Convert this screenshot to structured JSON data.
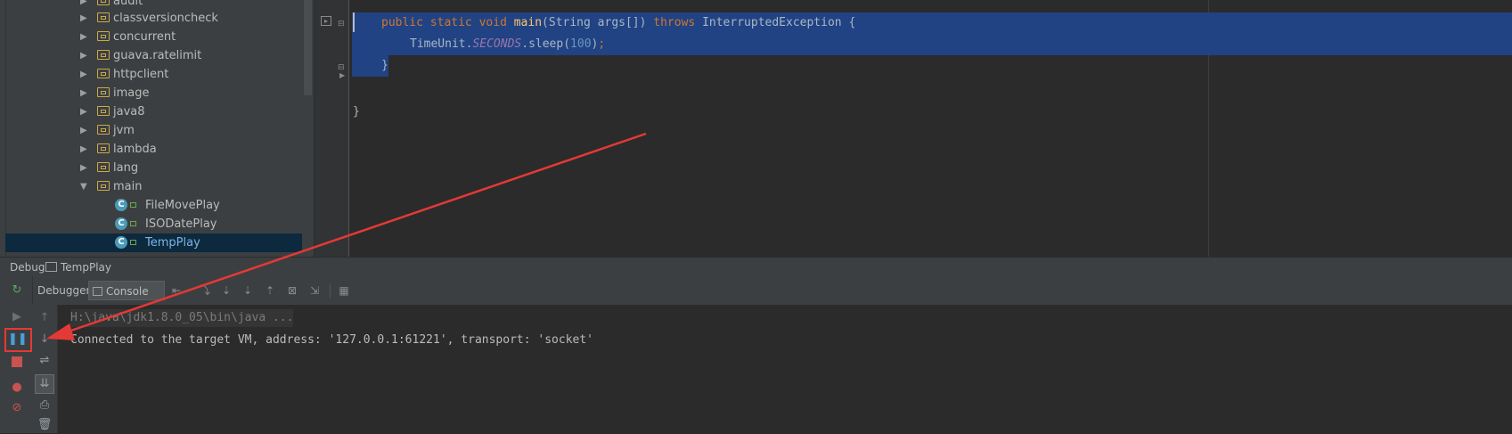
{
  "project_tree": {
    "items": [
      {
        "label": "audit",
        "type": "folder",
        "expanded": false
      },
      {
        "label": "classversioncheck",
        "type": "folder",
        "expanded": false
      },
      {
        "label": "concurrent",
        "type": "folder",
        "expanded": false
      },
      {
        "label": "guava.ratelimit",
        "type": "folder",
        "expanded": false
      },
      {
        "label": "httpclient",
        "type": "folder",
        "expanded": false
      },
      {
        "label": "image",
        "type": "folder",
        "expanded": false
      },
      {
        "label": "java8",
        "type": "folder",
        "expanded": false
      },
      {
        "label": "jvm",
        "type": "folder",
        "expanded": false
      },
      {
        "label": "lambda",
        "type": "folder",
        "expanded": false
      },
      {
        "label": "lang",
        "type": "folder",
        "expanded": false
      },
      {
        "label": "main",
        "type": "folder",
        "expanded": true
      },
      {
        "label": "FileMovePlay",
        "type": "class"
      },
      {
        "label": "ISODatePlay",
        "type": "class"
      },
      {
        "label": "TempPlay",
        "type": "class",
        "selected": true
      }
    ]
  },
  "editor": {
    "line1": {
      "kw1": "public",
      "kw2": "static",
      "kw3": "void",
      "method": "main",
      "params": "(String args[])",
      "kw4": "throws",
      "exc": "InterruptedException {"
    },
    "line2": {
      "cls": "TimeUnit.",
      "field": "SECONDS",
      "call": ".sleep(",
      "num": "100",
      "close": ")",
      "semi": ";"
    },
    "line3": "}",
    "line4": "}"
  },
  "debug": {
    "title": "Debug",
    "config_name": "TempPlay",
    "tabs": {
      "debugger": "Debugger",
      "console": "Console",
      "console_suffix": "→*"
    },
    "console_lines": [
      "H:\\java\\jdk1.8.0_05\\bin\\java ...",
      "Connected to the target VM, address: '127.0.0.1:61221', transport: 'socket'"
    ]
  },
  "colors": {
    "accent_selection": "#214283",
    "annotation": "#e53935"
  }
}
